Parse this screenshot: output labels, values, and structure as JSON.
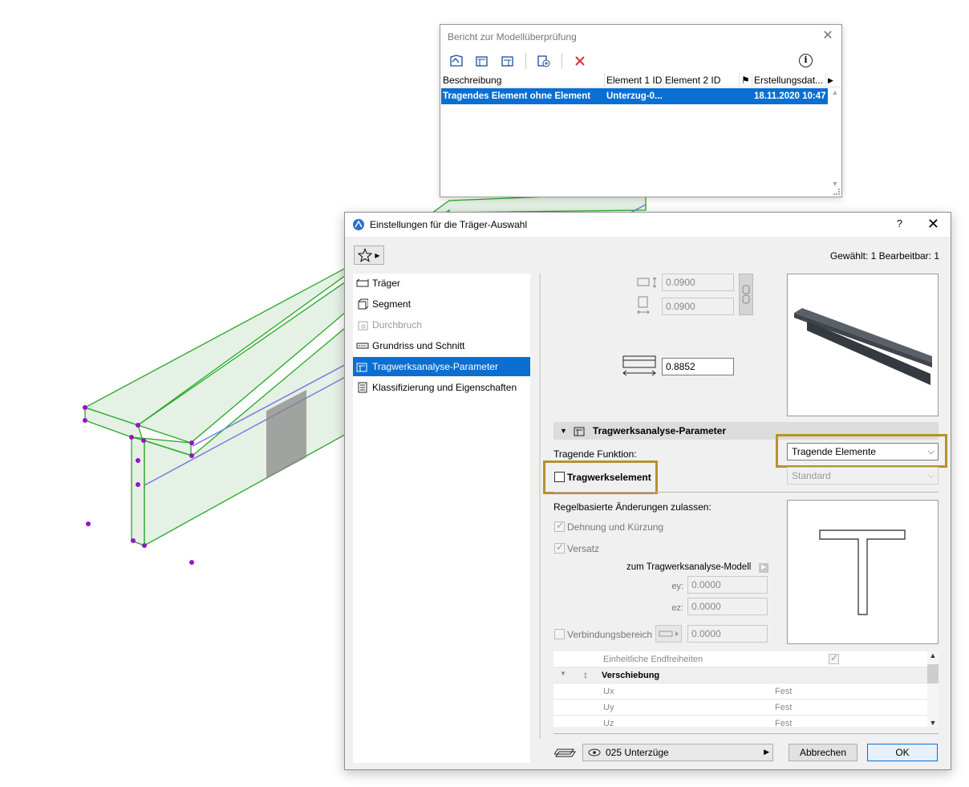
{
  "report_window": {
    "title": "Bericht zur Modellüberprüfung",
    "columns": [
      "Beschreibung",
      "Element 1 ID",
      "Element 2 ID",
      "Erstellungsdat..."
    ],
    "rows": [
      {
        "beschreibung": "Tragendes Element ohne Element",
        "element1": "Unterzug-0...",
        "element2": "",
        "datum": "18.11.2020 10:47"
      }
    ],
    "icons": [
      "model-check-icon",
      "beam-report-icon",
      "beam-report-alt-icon",
      "add-report-icon",
      "delete-icon",
      "info-icon"
    ]
  },
  "dialog": {
    "title": "Einstellungen für die Träger-Auswahl",
    "help": "?",
    "close": "✕",
    "selection_info": "Gewählt: 1 Bearbeitbar: 1",
    "nav": [
      {
        "label": "Träger",
        "state": "normal"
      },
      {
        "label": "Segment",
        "state": "normal"
      },
      {
        "label": "Durchbruch",
        "state": "disabled"
      },
      {
        "label": "Grundriss und Schnitt",
        "state": "normal"
      },
      {
        "label": "Tragwerksanalyse-Parameter",
        "state": "active"
      },
      {
        "label": "Klassifizierung und Eigenschaften",
        "state": "normal"
      }
    ],
    "dimensions": {
      "width": "0.0900",
      "height": "0.0900",
      "offset": "0.8852"
    },
    "section_title": "Tragwerksanalyse-Parameter",
    "tragende_funktion_label": "Tragende Funktion:",
    "tragende_funktion_value": "Tragende Elemente",
    "tragwerkselement_label": "Tragwerkselement",
    "standard_value": "Standard",
    "regel_label": "Regelbasierte Änderungen zulassen:",
    "dehnung_label": "Dehnung und Kürzung",
    "versatz_label": "Versatz",
    "modell_label": "zum Tragwerksanalyse-Modell",
    "ey_label": "ey:",
    "ey_value": "0.0000",
    "ez_label": "ez:",
    "ez_value": "0.0000",
    "verbindung_label": "Verbindungsbereich",
    "verbindung_value": "0.0000",
    "table": {
      "row1": "Einheitliche Endfreiheiten",
      "group": "Verschiebung",
      "ux": "Ux",
      "ux_val": "Fest",
      "uy": "Uy",
      "uy_val": "Fest",
      "uz": "Uz",
      "uz_val": "Fest"
    },
    "layer": "025 Unterzüge",
    "cancel": "Abbrechen",
    "ok": "OK"
  },
  "colors": {
    "accent": "#0a6fd0",
    "highlight": "#b8912f",
    "model_green": "#22aa22",
    "model_fill": "#d4e8d4",
    "node_purple": "#9a10c8",
    "axis_blue": "#7a7ae0"
  }
}
